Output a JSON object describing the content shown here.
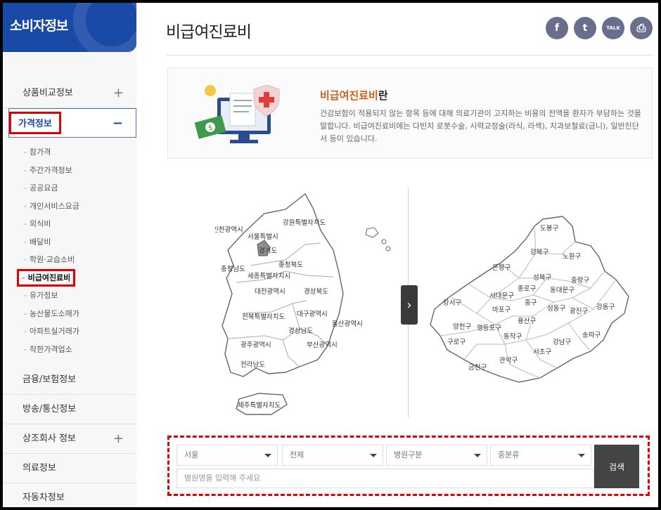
{
  "sidebar": {
    "title": "소비자정보",
    "items_top": [
      {
        "label": "상품비교정보",
        "toggle": "+"
      }
    ],
    "active": {
      "label": "가격정보",
      "toggle": "−"
    },
    "sub_items": [
      "참가격",
      "주간가격정보",
      "공공요금",
      "개인서비스요금",
      "외식비",
      "배달비",
      "학원·교습소비",
      "비급여진료비",
      "유가정보",
      "농산물도소매가",
      "아파트실거래가",
      "착한가격업소"
    ],
    "items_bottom": [
      {
        "label": "금융/보험정보",
        "toggle": ""
      },
      {
        "label": "방송/통신정보",
        "toggle": ""
      },
      {
        "label": "상조회사 정보",
        "toggle": "+"
      },
      {
        "label": "의료정보",
        "toggle": ""
      },
      {
        "label": "자동차정보",
        "toggle": ""
      }
    ]
  },
  "header": {
    "title": "비급여진료비",
    "share": [
      {
        "name": "facebook-icon",
        "glyph": "f"
      },
      {
        "name": "twitter-icon",
        "glyph": "t"
      },
      {
        "name": "talk-icon",
        "glyph": "TALK"
      },
      {
        "name": "print-icon",
        "glyph": "⎙"
      }
    ]
  },
  "info": {
    "heading_hl": "비급여진료비",
    "heading_rest": "란",
    "text": "건강보험이 적용되지 않는 항목 등에 대해 의료기관이 고지하는 비용의 전액을 환자가 부담하는 것을 말합니다. 비급여진료비에는 다빈치 로봇수술, 시력교정술(라식, 라섹), 치과보철료(금니), 일반진단서 등이 있습니다."
  },
  "korea_regions": [
    "인천광역시",
    "강원특별자치도",
    "서울특별시",
    "경기도",
    "충청남도",
    "충청북도",
    "세종특별자치시",
    "대전광역시",
    "경상북도",
    "전북특별자치도",
    "대구광역시",
    "울산광역시",
    "경상남도",
    "광주광역시",
    "부산광역시",
    "전라남도",
    "제주특별자치도"
  ],
  "seoul_districts": [
    "도봉구",
    "강북구",
    "노원구",
    "은평구",
    "성북구",
    "중랑구",
    "종로구",
    "서대문구",
    "동대문구",
    "강서구",
    "중구",
    "마포구",
    "성동구",
    "광진구",
    "강동구",
    "용산구",
    "양천구",
    "영등포구",
    "동작구",
    "송파구",
    "구로구",
    "강남구",
    "서초구",
    "관악구",
    "금천구"
  ],
  "search": {
    "selects": [
      "서울",
      "전체",
      "병원구분",
      "중분류"
    ],
    "placeholder": "병원명을 입력해 주세요",
    "button": "검색"
  }
}
